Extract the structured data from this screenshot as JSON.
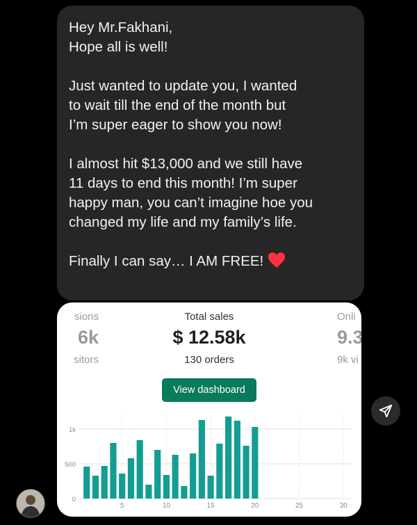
{
  "message": {
    "paragraphs": [
      [
        "Hey Mr.Fakhani,",
        "Hope all is well!"
      ],
      [
        "Just wanted to update you, I wanted",
        "to wait till the end of the month but",
        "I’m super eager to show you now!"
      ],
      [
        "I almost hit $13,000 and we still have",
        "11 days to end this month! I’m super",
        "happy man, you can’t imagine hoe you",
        "changed my life and my family’s life."
      ],
      [
        "Finally I can say… I AM FREE!"
      ]
    ],
    "emoji": "❤️",
    "emoji_icon": "red-heart-icon"
  },
  "dashboard": {
    "left_metric": {
      "label": "sions",
      "value": "6k",
      "sub": "sitors"
    },
    "center_metric": {
      "label": "Total sales",
      "value": "$ 12.58k",
      "sub": "130 orders"
    },
    "right_metric": {
      "label": "Onli",
      "value": "9.3",
      "sub": "9k vi"
    },
    "button_label": "View dashboard",
    "accent_color": "#0a7a5c",
    "bar_color": "#149d93"
  },
  "chart_data": {
    "type": "bar",
    "x": [
      1,
      2,
      3,
      4,
      5,
      6,
      7,
      8,
      9,
      10,
      11,
      12,
      13,
      14,
      15,
      16,
      17,
      18,
      19,
      20
    ],
    "values": [
      460,
      330,
      470,
      800,
      360,
      580,
      840,
      200,
      700,
      340,
      630,
      180,
      650,
      1130,
      330,
      790,
      1180,
      1120,
      760,
      1030
    ],
    "xlim": [
      0,
      31
    ],
    "ylim": [
      0,
      1200
    ],
    "x_ticks": [
      "5",
      "10",
      "15",
      "20",
      "25",
      "30"
    ],
    "y_ticks": [
      "0",
      "500",
      "1k"
    ],
    "grid": true
  },
  "composer": {
    "send_icon": "send-icon",
    "avatar": "user-avatar"
  }
}
